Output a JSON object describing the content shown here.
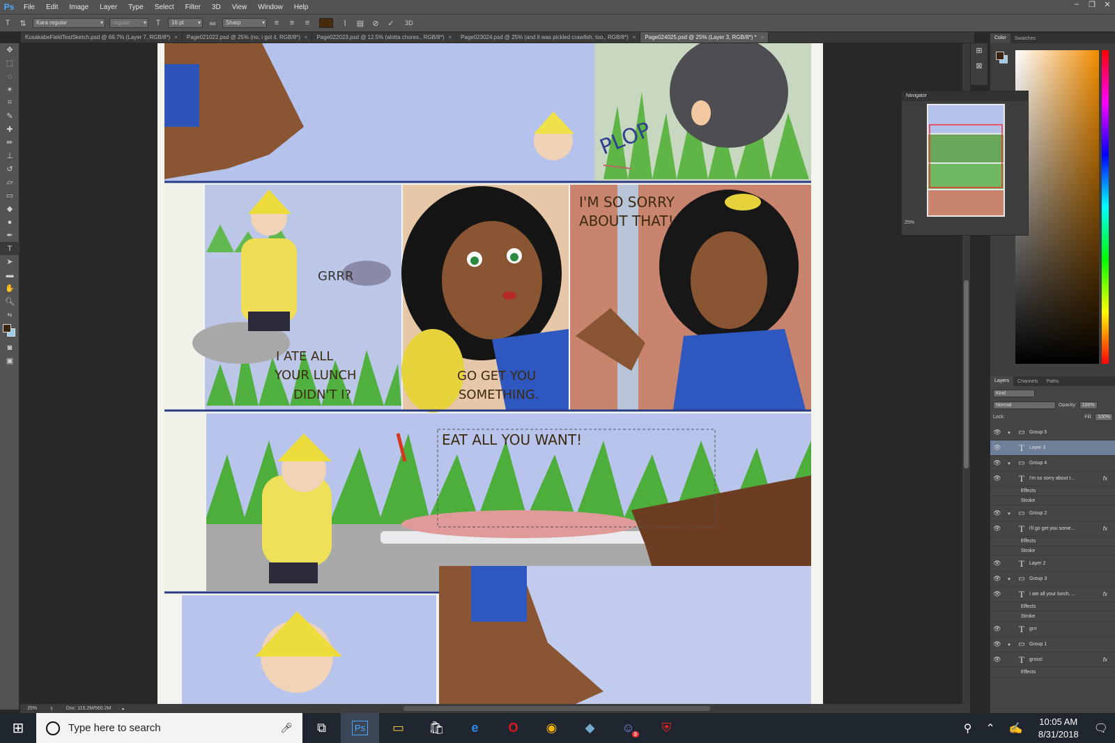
{
  "menubar": {
    "logo": "Ps",
    "items": [
      "File",
      "Edit",
      "Image",
      "Layer",
      "Type",
      "Select",
      "Filter",
      "3D",
      "View",
      "Window",
      "Help"
    ],
    "window_controls": [
      "–",
      "❐",
      "✕"
    ]
  },
  "options": {
    "font_family": "Kara regular",
    "font_style": "regular",
    "font_size": "16 pt",
    "aa_label": "aa",
    "antialias": "Sharp",
    "threed": "3D",
    "text_color": "#4a2a0c"
  },
  "tabs": [
    {
      "label": "KusakabeFieldTestSketch.psd @ 66.7% (Layer 7, RGB/8*)",
      "active": false
    },
    {
      "label": "Page021022.psd @ 25% (no, i got it, RGB/8*)",
      "active": false
    },
    {
      "label": "Page022023.psd @ 12.5% (alotta chores., RGB/8*)",
      "active": false
    },
    {
      "label": "Page023024.psd @ 25% (and  it was  pickled  crawfish,  too., RGB/8*)",
      "active": false
    },
    {
      "label": "Page024025.psd @ 25% (Layer 3, RGB/8*) *",
      "active": true
    }
  ],
  "tab_close": "×",
  "comic": {
    "sfx_plop": "PLOP",
    "sfx_grrr": "GRRR",
    "bubble_sorry_1": "I'M SO SORRY",
    "bubble_sorry_2": "ABOUT THAT!",
    "bubble_ate_1": "I ATE ALL",
    "bubble_ate_2": "YOUR LUNCH",
    "bubble_ate_3": "DIDN'T I?",
    "bubble_go_1": "GO GET YOU",
    "bubble_go_2": "SOMETHING.",
    "bubble_eat": "EAT ALL YOU WANT!"
  },
  "status": {
    "zoom": "25%",
    "doc": "Doc: 115.2M/560.2M"
  },
  "navigator": {
    "title": "Navigator",
    "zoom": "25%"
  },
  "color_panel": {
    "tabs": [
      "Color",
      "Swatches"
    ],
    "fg": "#3a2410",
    "bg": "#9ccde8"
  },
  "layers_panel": {
    "tabs": [
      "Layers",
      "Channels",
      "Paths"
    ],
    "kind": "Kind",
    "blend_mode": "Normal",
    "opacity_label": "Opacity:",
    "opacity": "100%",
    "lock_label": "Lock:",
    "fill_label": "Fill:",
    "fill": "100%",
    "rows": [
      {
        "name": "Group 5",
        "type": "group",
        "selected": false,
        "fx": false
      },
      {
        "name": "Layer 3",
        "type": "text",
        "selected": true,
        "fx": false
      },
      {
        "name": "Group 4",
        "type": "group",
        "selected": false,
        "fx": false
      },
      {
        "name": "I'm so sorry about t...",
        "type": "text",
        "selected": false,
        "fx": true
      },
      {
        "name": "Effects",
        "type": "effect",
        "selected": false,
        "fx": false
      },
      {
        "name": "Stroke",
        "type": "effect",
        "selected": false,
        "fx": false
      },
      {
        "name": "Group 2",
        "type": "group",
        "selected": false,
        "fx": false
      },
      {
        "name": "i'll go get you some...",
        "type": "text",
        "selected": false,
        "fx": true
      },
      {
        "name": "Effects",
        "type": "effect",
        "selected": false,
        "fx": false
      },
      {
        "name": "Stroke",
        "type": "effect",
        "selected": false,
        "fx": false
      },
      {
        "name": "Layer 2",
        "type": "text",
        "selected": false,
        "fx": false
      },
      {
        "name": "Group 3",
        "type": "group",
        "selected": false,
        "fx": false
      },
      {
        "name": "I ate all your lunch, ...",
        "type": "text",
        "selected": false,
        "fx": true
      },
      {
        "name": "Effects",
        "type": "effect",
        "selected": false,
        "fx": false
      },
      {
        "name": "Stroke",
        "type": "effect",
        "selected": false,
        "fx": false
      },
      {
        "name": "grrr",
        "type": "text",
        "selected": false,
        "fx": false
      },
      {
        "name": "Group 1",
        "type": "group",
        "selected": false,
        "fx": false
      },
      {
        "name": "gross!",
        "type": "text",
        "selected": false,
        "fx": true
      },
      {
        "name": "Effects",
        "type": "effect",
        "selected": false,
        "fx": false
      }
    ]
  },
  "taskbar": {
    "search_placeholder": "Type here to search",
    "apps": [
      "task-view",
      "photoshop",
      "file-explorer",
      "store",
      "edge",
      "opera",
      "chrome",
      "app-7",
      "discord",
      "shield"
    ],
    "ps_label": "Ps",
    "discord_badge": "9",
    "time": "10:05 AM",
    "date": "8/31/2018"
  }
}
